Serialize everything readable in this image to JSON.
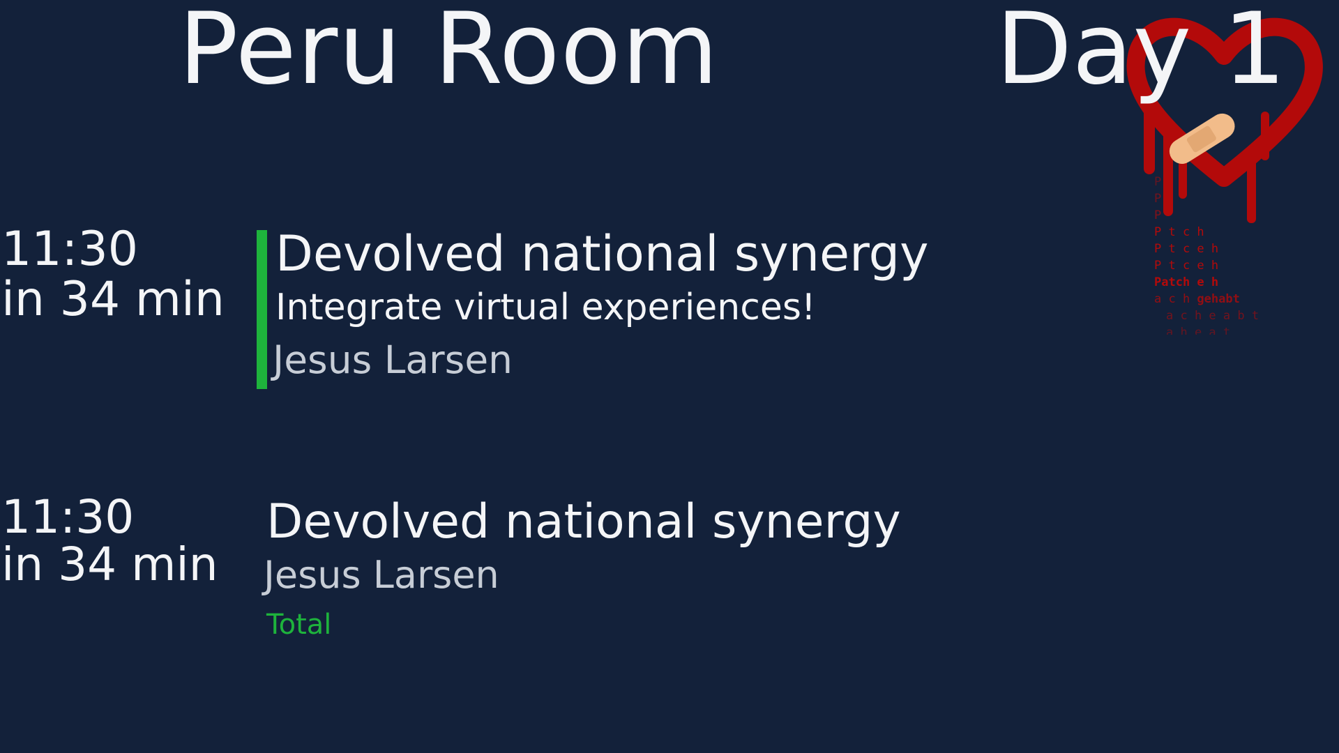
{
  "header": {
    "room": "Peru Room",
    "day": "Day 1"
  },
  "colors": {
    "background": "#13213a",
    "text": "#f4f5f7",
    "muted": "#c7cdd6",
    "accent": "#1eb33c",
    "logo_red": "#b30a0a",
    "bandage": "#f2bc8a"
  },
  "logo": {
    "icon": "bleeding-heart-bandage-icon",
    "art_text": "Patch gehabt"
  },
  "talks": [
    {
      "time": "11:30",
      "countdown": "in 34 min",
      "title": "Devolved national synergy",
      "subtitle": "Integrate virtual experiences!",
      "speaker": "Jesus Larsen",
      "current": true
    },
    {
      "time": "11:30",
      "countdown": "in 34 min",
      "title": "Devolved national synergy",
      "speaker": "Jesus Larsen",
      "track": "Total",
      "current": false
    }
  ]
}
